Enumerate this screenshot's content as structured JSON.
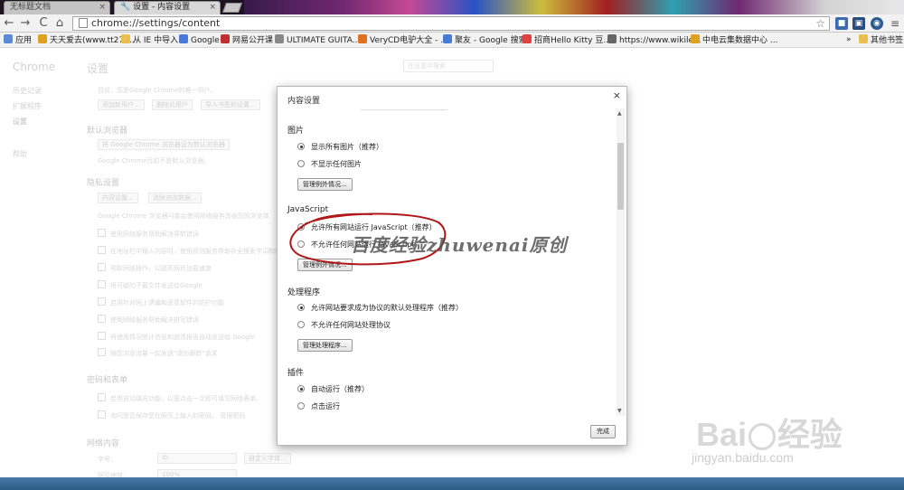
{
  "tabs": [
    {
      "title": "无标题文档",
      "active": false
    },
    {
      "title": "设置 - 内容设置",
      "active": true
    }
  ],
  "toolbar": {
    "url": "chrome://settings/content",
    "back": "←",
    "forward": "→",
    "reload": "C",
    "home": "⌂",
    "star": "☆"
  },
  "bookmarks": [
    {
      "label": "应用",
      "color": "#5a8ad8"
    },
    {
      "label": "天天爱去(www.tt27....",
      "color": "#e0a020"
    },
    {
      "label": "从 IE 中导入",
      "color": "#e8c050"
    },
    {
      "label": "Google",
      "color": "#4a7ad8"
    },
    {
      "label": "网易公开课",
      "color": "#c03030"
    },
    {
      "label": "ULTIMATE GUITA...",
      "color": "#888888"
    },
    {
      "label": "VeryCD电驴大全 - ...",
      "color": "#e07020"
    },
    {
      "label": "聚友 - Google 搜索",
      "color": "#4a7ad8"
    },
    {
      "label": "招商Hello Kitty 豆...",
      "color": "#e04040"
    },
    {
      "label": "https://www.wikile...",
      "color": "#666666"
    },
    {
      "label": "中电云集数据中心 ...",
      "color": "#e0a020"
    },
    {
      "label": "»",
      "color": ""
    },
    {
      "label": "其他书签",
      "color": "#e8c050"
    }
  ],
  "settings": {
    "sidebar_title": "Chrome",
    "sidebar": [
      "历史记录",
      "扩展程序",
      "设置",
      "帮助"
    ],
    "page_title": "设置",
    "search_placeholder": "在设置中搜索",
    "user_text": "目前，您是Google Chrome的唯一用户。",
    "user_buttons": [
      "添加新用户...",
      "删除此用户",
      "导入书签和设置..."
    ],
    "default_browser_head": "默认浏览器",
    "default_browser_btn": "将 Google Chrome 浏览器设为默认浏览器",
    "default_browser_note": "Google Chrome目前不是默认浏览器。",
    "privacy_head": "隐私设置",
    "privacy_buttons": [
      "内容设置...",
      "清除浏览数据..."
    ],
    "privacy_note": "Google Chrome 浏览器可能会使用网络服务改善您的浏览体",
    "privacy_checks": [
      "使用网络服务帮助解决导航错误",
      "在地址栏中输入内容时，使用预测服务帮助补全搜索字词和网址",
      "预取网络操作，以提高网页加载速度",
      "将可疑的下载文件发送给Google",
      "启用针对网上诱骗和恶意软件的防护功能",
      "使用网络服务帮助解决拼写错误",
      "将使用情况统计信息和崩溃报告自动发送给 Google",
      "随您浏览流量一起发送\"请勿跟踪\"请求"
    ],
    "passwords_head": "密码和表单",
    "passwords_checks": [
      "启用自动填充功能，以便点击一次即可填写网络表单。",
      "询问是否保存您在网页上输入的密码。 管理密码"
    ],
    "web_content_head": "网络内容",
    "font_size_label": "字号：",
    "font_size_value": "中",
    "custom_fonts_btn": "自定义字体...",
    "zoom_label": "网页缩放：",
    "zoom_value": "100%"
  },
  "dialog": {
    "title": "内容设置",
    "close": "×",
    "images_head": "图片",
    "images_options": [
      "显示所有图片（推荐）",
      "不显示任何图片"
    ],
    "images_selected": 0,
    "images_btn": "管理例外情况...",
    "js_head": "JavaScript",
    "js_options": [
      "允许所有网站运行 JavaScript（推荐）",
      "不允许任何网站运行 JavaScript"
    ],
    "js_selected": 0,
    "js_btn": "管理例外情况...",
    "handlers_head": "处理程序",
    "handlers_options": [
      "允许网站要求成为协议的默认处理程序（推荐）",
      "不允许任何网站处理协议"
    ],
    "handlers_selected": 0,
    "handlers_btn": "管理处理程序...",
    "plugins_head": "插件",
    "plugins_options": [
      "自动运行（推荐）",
      "点击运行"
    ],
    "plugins_selected": 0,
    "done": "完成"
  },
  "watermark": {
    "text": "百度经验zhuwenai原创",
    "logo": "Bai",
    "logo_suffix": "经验",
    "url": "jingyan.baidu.com",
    "annotation_color": "#b01818"
  }
}
